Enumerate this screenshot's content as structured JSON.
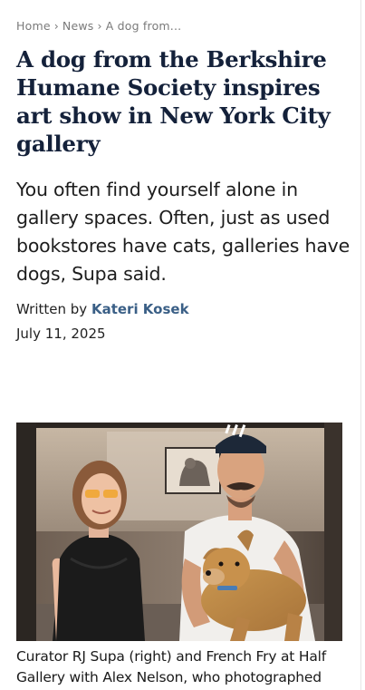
{
  "breadcrumb": {
    "home": "Home",
    "separator": "›",
    "section": "News",
    "current": "A dog from..."
  },
  "article": {
    "headline": "A dog from the Berkshire Humane Society inspires art show in New York City gallery",
    "dek": "You often find yourself alone in gallery spaces. Often, just as used bookstores have cats, galleries have dogs, Supa said.",
    "byline_prefix": "Written by",
    "author": "Kateri Kosek",
    "date": "July 11, 2025"
  },
  "figure": {
    "caption": "Curator RJ Supa (right) and French Fry at Half Gallery with Alex Nelson, who photographed"
  },
  "colors": {
    "headline": "#14213a",
    "author_link": "#3a5f86",
    "breadcrumb": "#7a7a7a"
  }
}
